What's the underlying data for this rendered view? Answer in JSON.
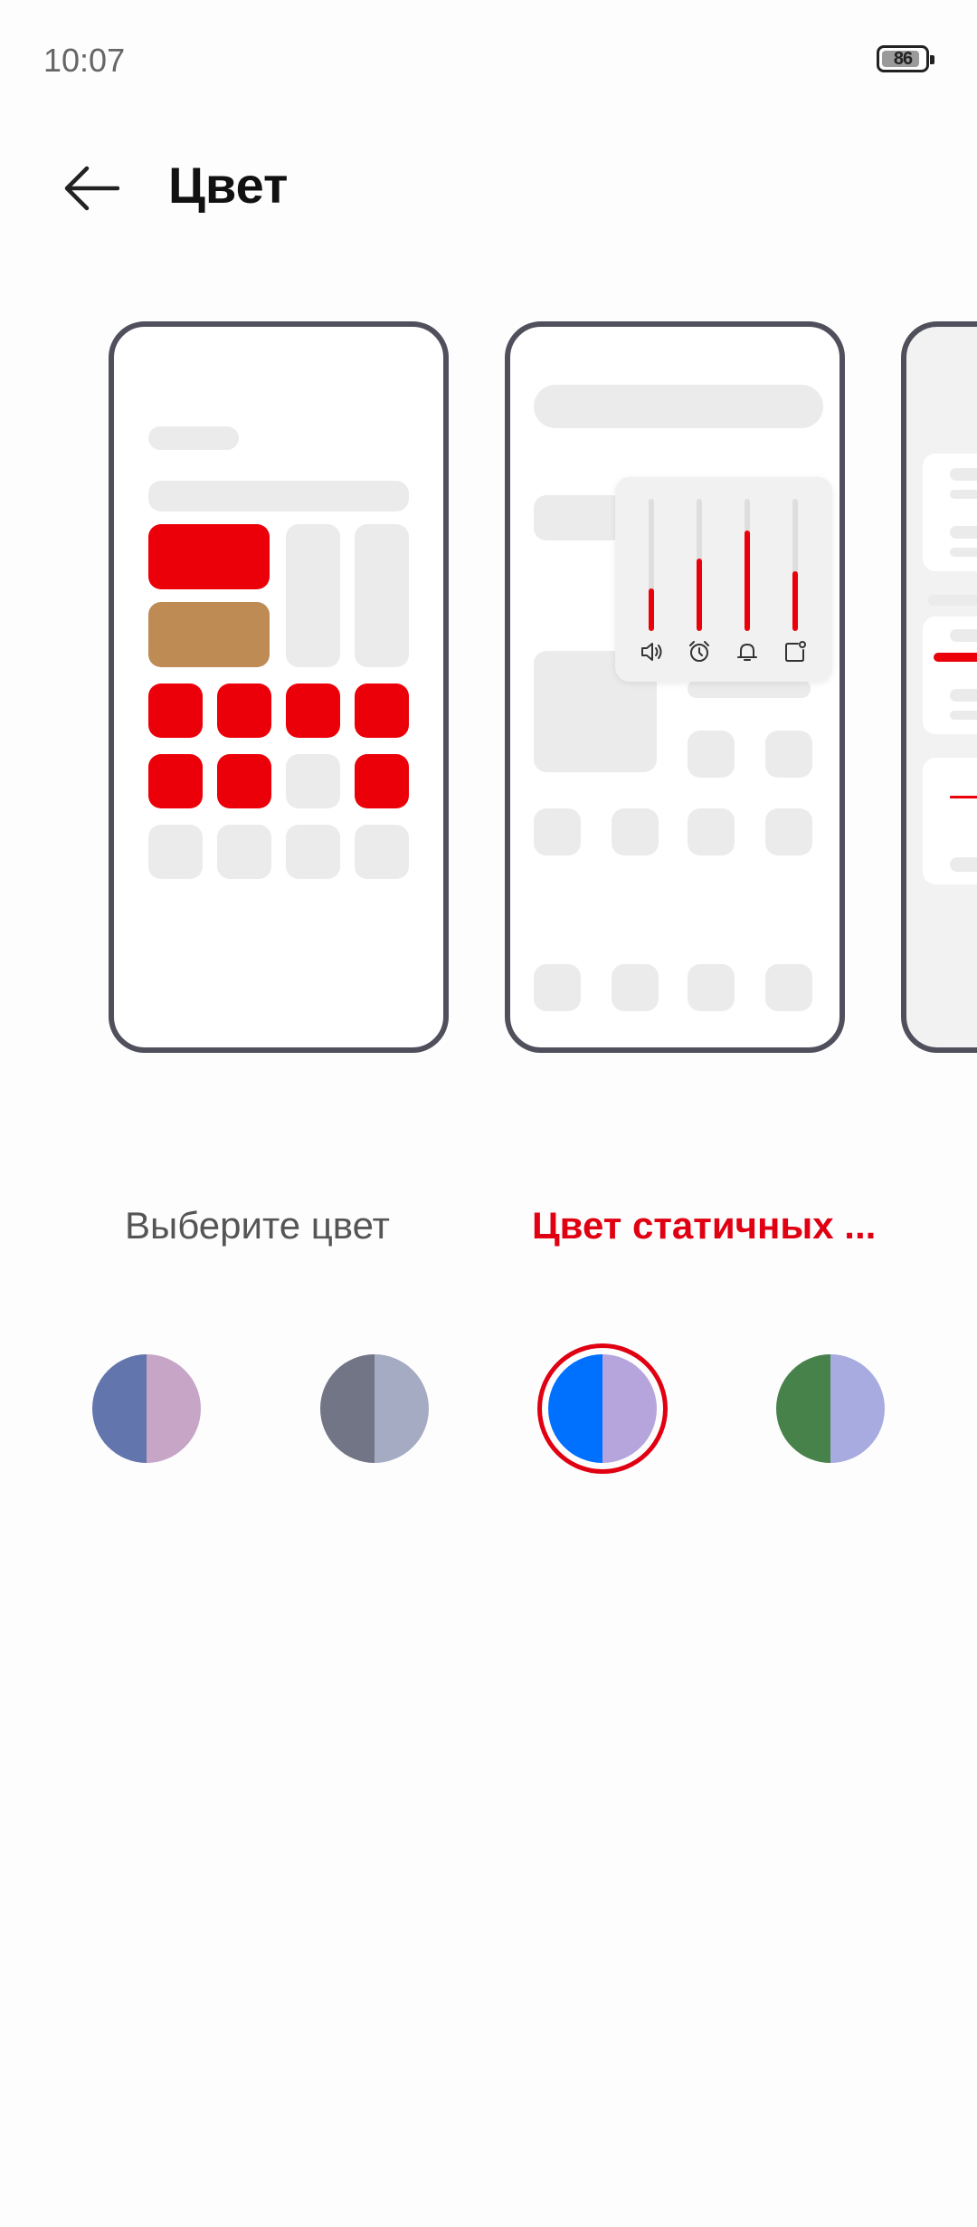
{
  "status_bar": {
    "time": "10:07",
    "battery": "86"
  },
  "header": {
    "title": "Цвет"
  },
  "tabs": [
    {
      "label": "Выберите цвет",
      "selected": false
    },
    {
      "label": "Цвет статичных ...",
      "selected": true
    }
  ],
  "swatches": [
    {
      "name": "blue-pink",
      "left": "#6275ad",
      "right": "#c6a5c6",
      "selected": false
    },
    {
      "name": "grey-lavender",
      "left": "#717585",
      "right": "#a4abc2",
      "selected": false
    },
    {
      "name": "blue-lilac",
      "left": "#0070ff",
      "right": "#b6a5dd",
      "selected": true
    },
    {
      "name": "green-periwinkle",
      "left": "#47824b",
      "right": "#a8abe0",
      "selected": false
    }
  ],
  "colors": {
    "accent": "#e00012",
    "preview_accent": "#eb0009",
    "preview_secondary": "#bd8b53",
    "frame": "#4f505c"
  },
  "preview": {
    "volume_levels": [
      0.32,
      0.55,
      0.76,
      0.45
    ]
  }
}
